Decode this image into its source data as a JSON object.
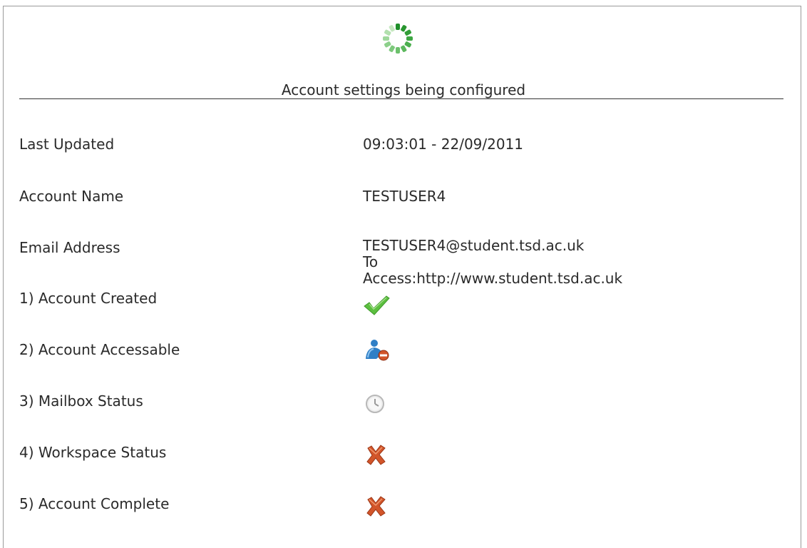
{
  "header": {
    "title": "Account settings being configured",
    "spinner_icon": "loading-spinner-icon",
    "accent_color": "#3aa83a"
  },
  "details": {
    "last_updated": {
      "label": "Last Updated",
      "value": "09:03:01 - 22/09/2011"
    },
    "account_name": {
      "label": "Account Name",
      "value": "TESTUSER4"
    },
    "email_address": {
      "label": "Email Address",
      "value": "TESTUSER4@student.tsd.ac.uk",
      "note_line1": "To",
      "note_line2": "Access:http://www.student.tsd.ac.uk"
    }
  },
  "steps": [
    {
      "label": "1) Account Created",
      "icon": "check-icon",
      "status_color": "#4caf3c"
    },
    {
      "label": "2) Account Accessable",
      "icon": "user-blocked-icon",
      "status_color": "#2f7fc6"
    },
    {
      "label": "3) Mailbox Status",
      "icon": "clock-icon",
      "status_color": "#b8b8b8"
    },
    {
      "label": "4) Workspace Status",
      "icon": "cross-icon",
      "status_color": "#d2552a"
    },
    {
      "label": "5) Account Complete",
      "icon": "cross-icon",
      "status_color": "#d2552a"
    }
  ]
}
